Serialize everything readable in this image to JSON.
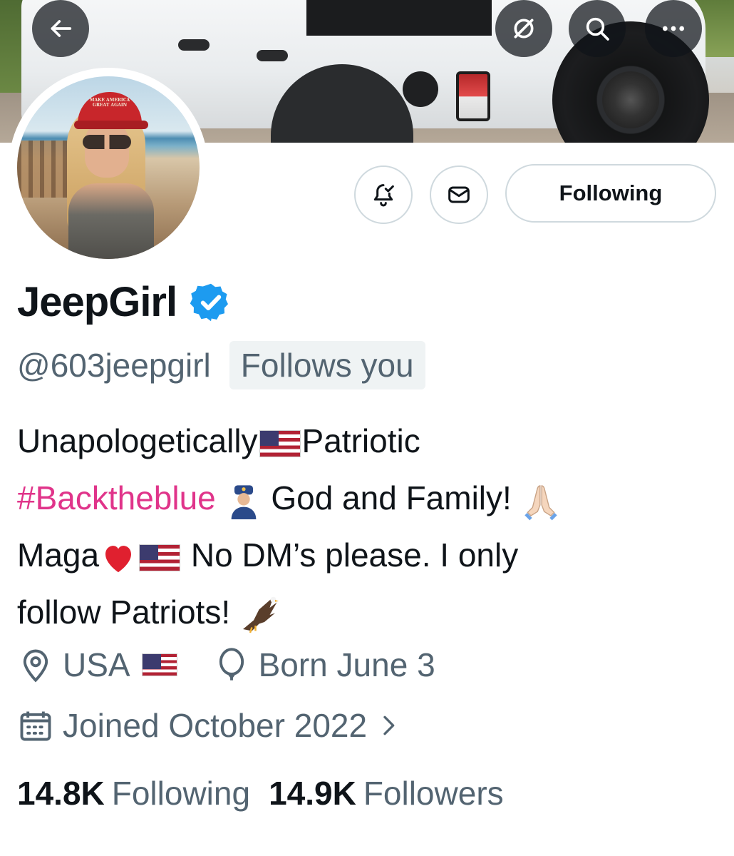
{
  "header": {
    "back_icon": "arrow-left-icon",
    "grok_icon": "grok-icon",
    "search_icon": "search-icon",
    "more_icon": "ellipsis-icon"
  },
  "avatar": {
    "hat_text": "MAKE AMERICA GREAT AGAIN"
  },
  "actions": {
    "notify_icon": "bell-check-icon",
    "message_icon": "envelope-icon",
    "follow_label": "Following"
  },
  "profile": {
    "name": "JeepGirl",
    "handle": "@603jeepgirl",
    "follows_you": "Follows you",
    "bio": {
      "line1_a": "Unapologetically",
      "line1_b": "Patriotic",
      "line2_hashtag": "#Backtheblue",
      "line2_b": "God and Family!",
      "line3_a": "Maga",
      "line3_b": "No DM’s please. I only",
      "line4_a": "follow Patriots!"
    },
    "location": "USA",
    "birthday": "Born June 3",
    "joined": "Joined October 2022",
    "following_count": "14.8K",
    "following_label": "Following",
    "followers_count": "14.9K",
    "followers_label": "Followers"
  },
  "colors": {
    "text_primary": "#0f1419",
    "text_secondary": "#536471",
    "hashtag": "#e0348a",
    "verified": "#1d9bf0",
    "border": "#cfd9de"
  }
}
